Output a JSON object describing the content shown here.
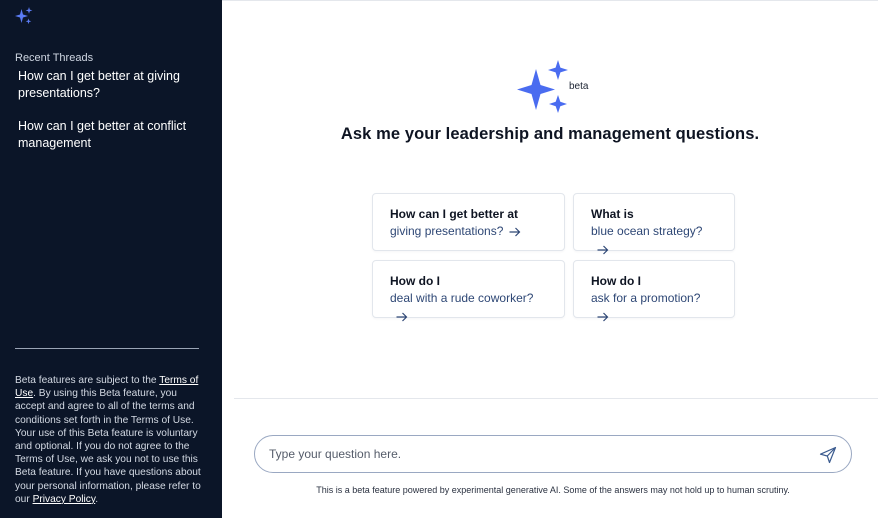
{
  "sidebar": {
    "logo_icon": "sparkle-icon",
    "recent_label": "Recent Threads",
    "threads": [
      {
        "label": "How can I get better at giving presentations?"
      },
      {
        "label": "How can I get better at conflict management"
      }
    ],
    "legal": {
      "prefix": "Beta features are subject to the ",
      "terms_link": "Terms of Use",
      "middle": ". By using this Beta feature, you accept and agree to all of the terms and conditions set forth in the Terms of Use. Your use of this Beta feature is voluntary and optional. If you do not agree to the Terms of Use, we ask you not to use this Beta feature. If you have questions about your personal information, please refer to our ",
      "privacy_link": "Privacy Policy",
      "suffix": "."
    }
  },
  "main": {
    "hero_icon": "sparkle-icon",
    "beta_label": "beta",
    "headline": "Ask me your leadership and management questions.",
    "suggestions": [
      {
        "title": "How can I get better at",
        "subtitle": "giving presentations?"
      },
      {
        "title": "What is",
        "subtitle": "blue ocean strategy?"
      },
      {
        "title": "How do I",
        "subtitle": "deal with a rude coworker?"
      },
      {
        "title": "How do I",
        "subtitle": "ask for a promotion?"
      }
    ],
    "input": {
      "placeholder": "Type your question here.",
      "value": ""
    },
    "send_icon": "send-icon",
    "disclaimer": "This is a beta feature powered by experimental generative AI. Some of the answers may not hold up to human scrutiny."
  },
  "colors": {
    "sidebar_bg": "#0b1528",
    "accent_blue": "#4a6cf0",
    "link_blue": "#2e4775"
  }
}
